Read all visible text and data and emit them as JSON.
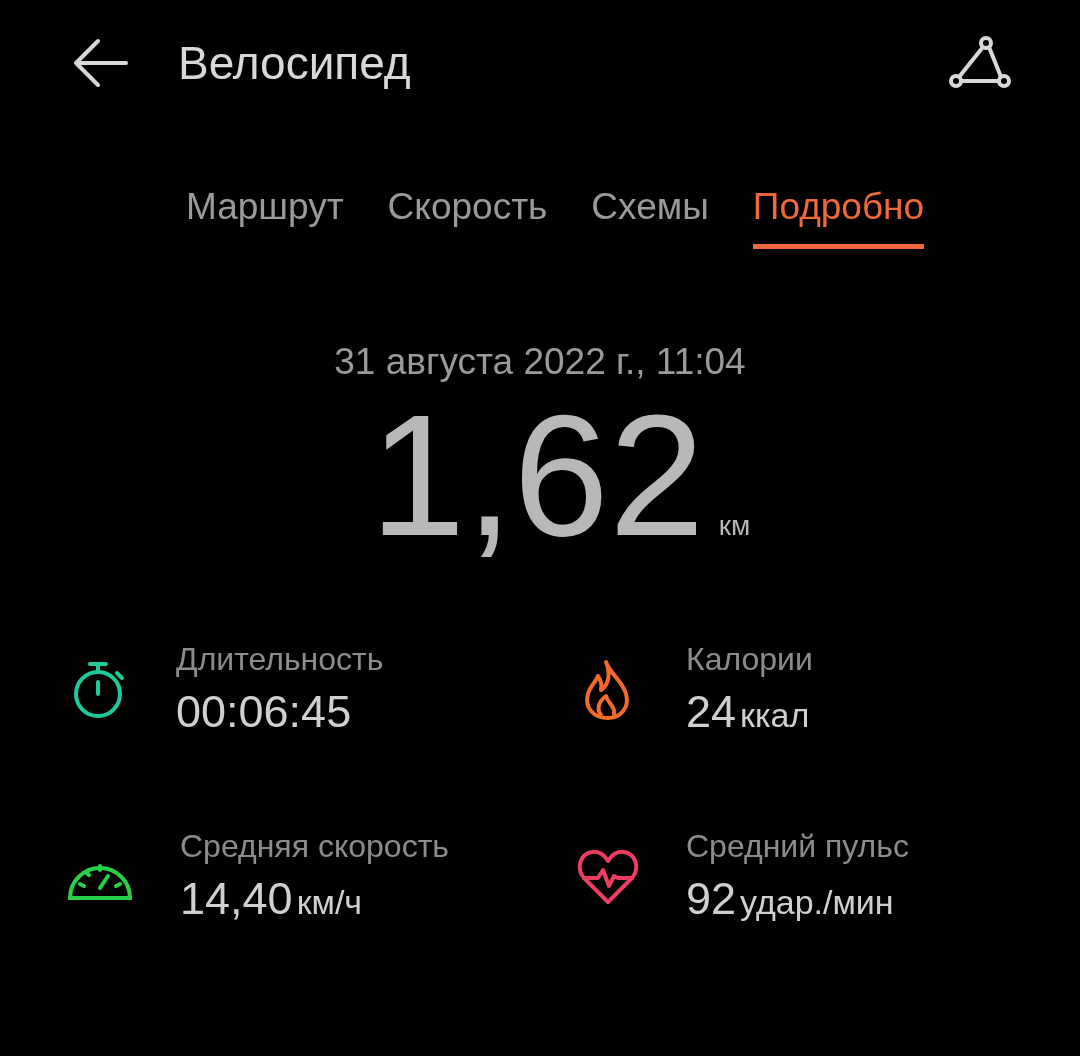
{
  "header": {
    "title": "Велосипед"
  },
  "tabs": [
    {
      "label": "Маршрут",
      "selected": false
    },
    {
      "label": "Скорость",
      "selected": false
    },
    {
      "label": "Схемы",
      "selected": false
    },
    {
      "label": "Подробно",
      "selected": true
    }
  ],
  "date": "31 августа 2022 г., 11:04",
  "distance": {
    "value": "1,62",
    "unit": "км"
  },
  "stats": [
    {
      "kind": "duration",
      "label": "Длительность",
      "value": "00:06:45",
      "color": "#1ec99b"
    },
    {
      "kind": "calories",
      "label": "Калории",
      "value": "24",
      "unit": "ккал",
      "color": "#f26b2a"
    },
    {
      "kind": "speed",
      "label": "Средняя скорость",
      "value": "14,40",
      "unit": "км/ч",
      "color": "#29d146"
    },
    {
      "kind": "pulse",
      "label": "Средний пульс",
      "value": "92",
      "unit": "удар./мин",
      "color": "#ee3d63"
    }
  ]
}
